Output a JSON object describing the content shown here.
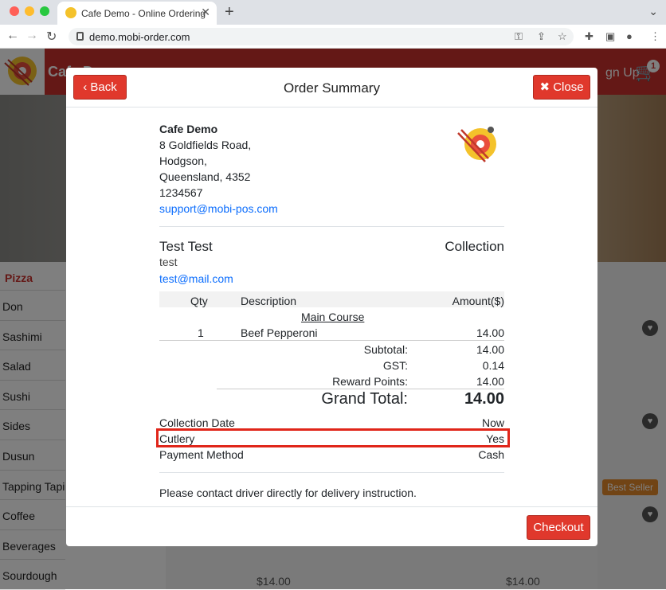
{
  "browser": {
    "tab_title": "Cafe Demo - Online Ordering",
    "url": "demo.mobi-order.com"
  },
  "app": {
    "name": "Cafe D",
    "signup": "gn Up",
    "cart_count": "1",
    "menu_items": [
      "Pizza",
      "Don",
      "Sashimi",
      "Salad",
      "Sushi",
      "Sides",
      "Dusun",
      "Tapping Tapioca",
      "Coffee",
      "Beverages",
      "Sourdough"
    ],
    "best_seller": "Best Seller",
    "prices": [
      "$14.00",
      "$14.00"
    ]
  },
  "modal": {
    "back_label": "Back",
    "title": "Order Summary",
    "close_label": "Close",
    "store": {
      "name": "Cafe Demo",
      "address1": "8 Goldfields Road,",
      "address2": "Hodgson,",
      "address3": "Queensland, 4352",
      "phone": "1234567",
      "email": "support@mobi-pos.com"
    },
    "customer": {
      "name": "Test Test",
      "order_type": "Collection",
      "note": "test",
      "email": "test@mail.com"
    },
    "table": {
      "headers": {
        "qty": "Qty",
        "description": "Description",
        "amount": "Amount($)"
      },
      "category": "Main Course",
      "rows": [
        {
          "qty": "1",
          "description": "Beef Pepperoni",
          "amount": "14.00"
        }
      ]
    },
    "totals": {
      "subtotal_label": "Subtotal:",
      "subtotal": "14.00",
      "gst_label": "GST:",
      "gst": "0.14",
      "reward_label": "Reward Points:",
      "reward": "14.00",
      "grand_label": "Grand Total:",
      "grand": "14.00"
    },
    "details": [
      {
        "label": "Collection Date",
        "value": "Now"
      },
      {
        "label": "Cutlery",
        "value": "Yes"
      },
      {
        "label": "Payment Method",
        "value": "Cash"
      }
    ],
    "notice": "Please contact driver directly for delivery instruction.",
    "checkout_label": "Checkout"
  }
}
